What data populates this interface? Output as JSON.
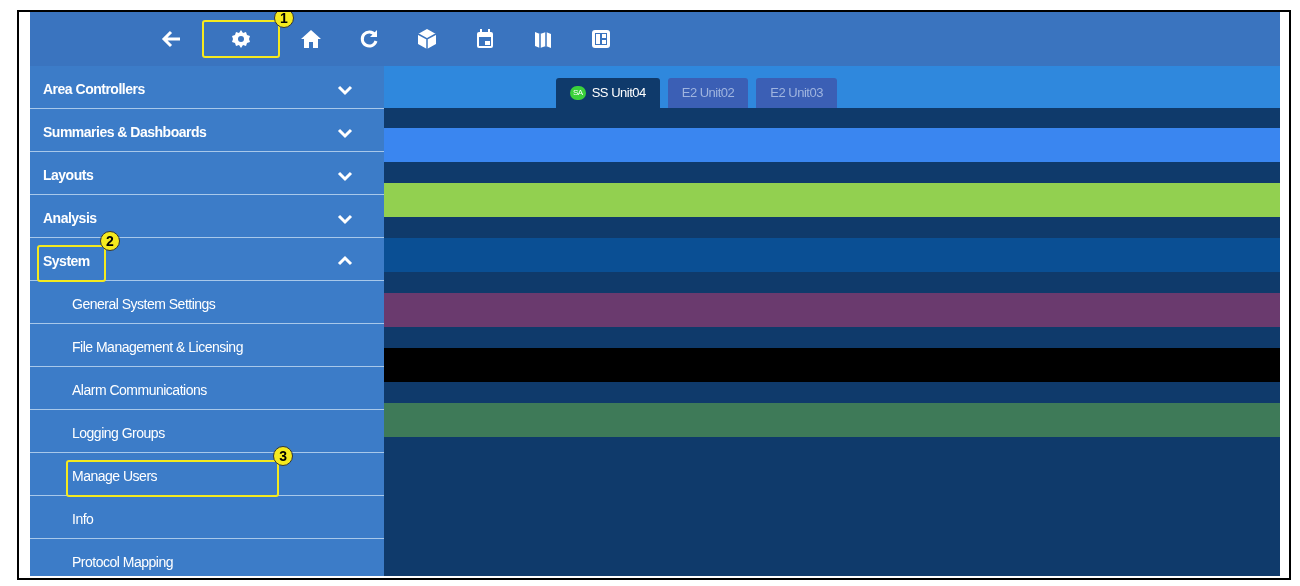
{
  "toolbar": [
    {
      "kind": "back"
    },
    {
      "kind": "settings",
      "callout": "1"
    },
    {
      "kind": "home"
    },
    {
      "kind": "refresh"
    },
    {
      "kind": "cube"
    },
    {
      "kind": "calendar"
    },
    {
      "kind": "map"
    },
    {
      "kind": "panel"
    }
  ],
  "sidebar": {
    "items": [
      {
        "label": "Area Controllers",
        "expanded": false
      },
      {
        "label": "Summaries & Dashboards",
        "expanded": false
      },
      {
        "label": "Layouts",
        "expanded": false
      },
      {
        "label": "Analysis",
        "expanded": false
      },
      {
        "label": "System",
        "expanded": true,
        "callout": "2",
        "children": [
          {
            "label": "General System Settings"
          },
          {
            "label": "File Management & Licensing"
          },
          {
            "label": "Alarm Communications"
          },
          {
            "label": "Logging Groups"
          },
          {
            "label": "Manage Users",
            "callout": "3"
          },
          {
            "label": "Info"
          },
          {
            "label": "Protocol Mapping"
          }
        ]
      }
    ]
  },
  "tabs": [
    {
      "label": "SS Unit04",
      "badge": "SA",
      "selected": true
    },
    {
      "label": "E2 Unit02",
      "selected": false
    },
    {
      "label": "E2 Unit03",
      "selected": false
    }
  ],
  "bands": [
    {
      "color": "#3a86f0"
    },
    {
      "color": "#92d050"
    },
    {
      "color": "#0a4f94"
    },
    {
      "color": "#6a3a6e"
    },
    {
      "color": "#000000"
    },
    {
      "color": "#3e7a58"
    }
  ]
}
